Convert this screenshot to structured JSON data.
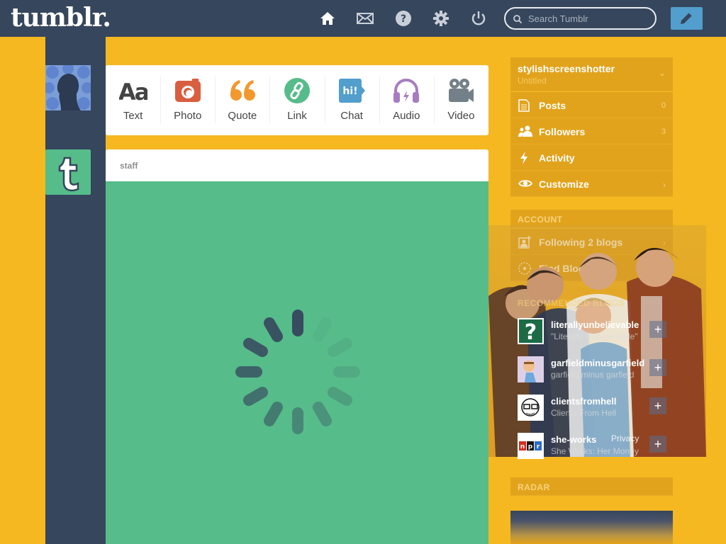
{
  "header": {
    "logo": "tumblr.",
    "search_placeholder": "Search Tumblr",
    "nav_icons": [
      "home-icon",
      "mail-icon",
      "help-icon",
      "gear-icon",
      "power-icon"
    ]
  },
  "post_types": [
    {
      "label": "Text",
      "icon": "text-icon",
      "color": "#444444"
    },
    {
      "label": "Photo",
      "icon": "camera-icon",
      "color": "#d95e40"
    },
    {
      "label": "Quote",
      "icon": "quote-icon",
      "color": "#f2992e"
    },
    {
      "label": "Link",
      "icon": "link-icon",
      "color": "#56bc8a"
    },
    {
      "label": "Chat",
      "icon": "chat-icon",
      "color": "#529ecc"
    },
    {
      "label": "Audio",
      "icon": "headphones-icon",
      "color": "#a77dc2"
    },
    {
      "label": "Video",
      "icon": "video-camera-icon",
      "color": "#748089"
    }
  ],
  "post": {
    "author": "staff"
  },
  "sidebar": {
    "blog_name": "stylishscreenshotter",
    "blog_subtitle": "Untitled",
    "items": [
      {
        "label": "Posts",
        "count": "0"
      },
      {
        "label": "Followers",
        "count": "3"
      },
      {
        "label": "Activity"
      },
      {
        "label": "Customize"
      }
    ],
    "account_header": "ACCOUNT",
    "account_items": [
      {
        "label": "Following 2 blogs"
      },
      {
        "label": "Find Blogs"
      }
    ],
    "recommended_header": "RECOMMENDED BLOGS",
    "recommended": [
      {
        "name": "literallyunbelievable",
        "subtitle": "\"Literally Unbelievable\""
      },
      {
        "name": "garfieldminusgarfield",
        "subtitle": "garfield minus garfield"
      },
      {
        "name": "clientsfromhell",
        "subtitle": "Clients From Hell"
      },
      {
        "name": "she-works",
        "subtitle": "She Works: Her Money"
      }
    ],
    "footer_link": "Privacy",
    "radar_header": "RADAR"
  },
  "colors": {
    "navy": "#36465d",
    "background": "#f5b821",
    "accent": "#529ecc",
    "green": "#56bc8a"
  }
}
